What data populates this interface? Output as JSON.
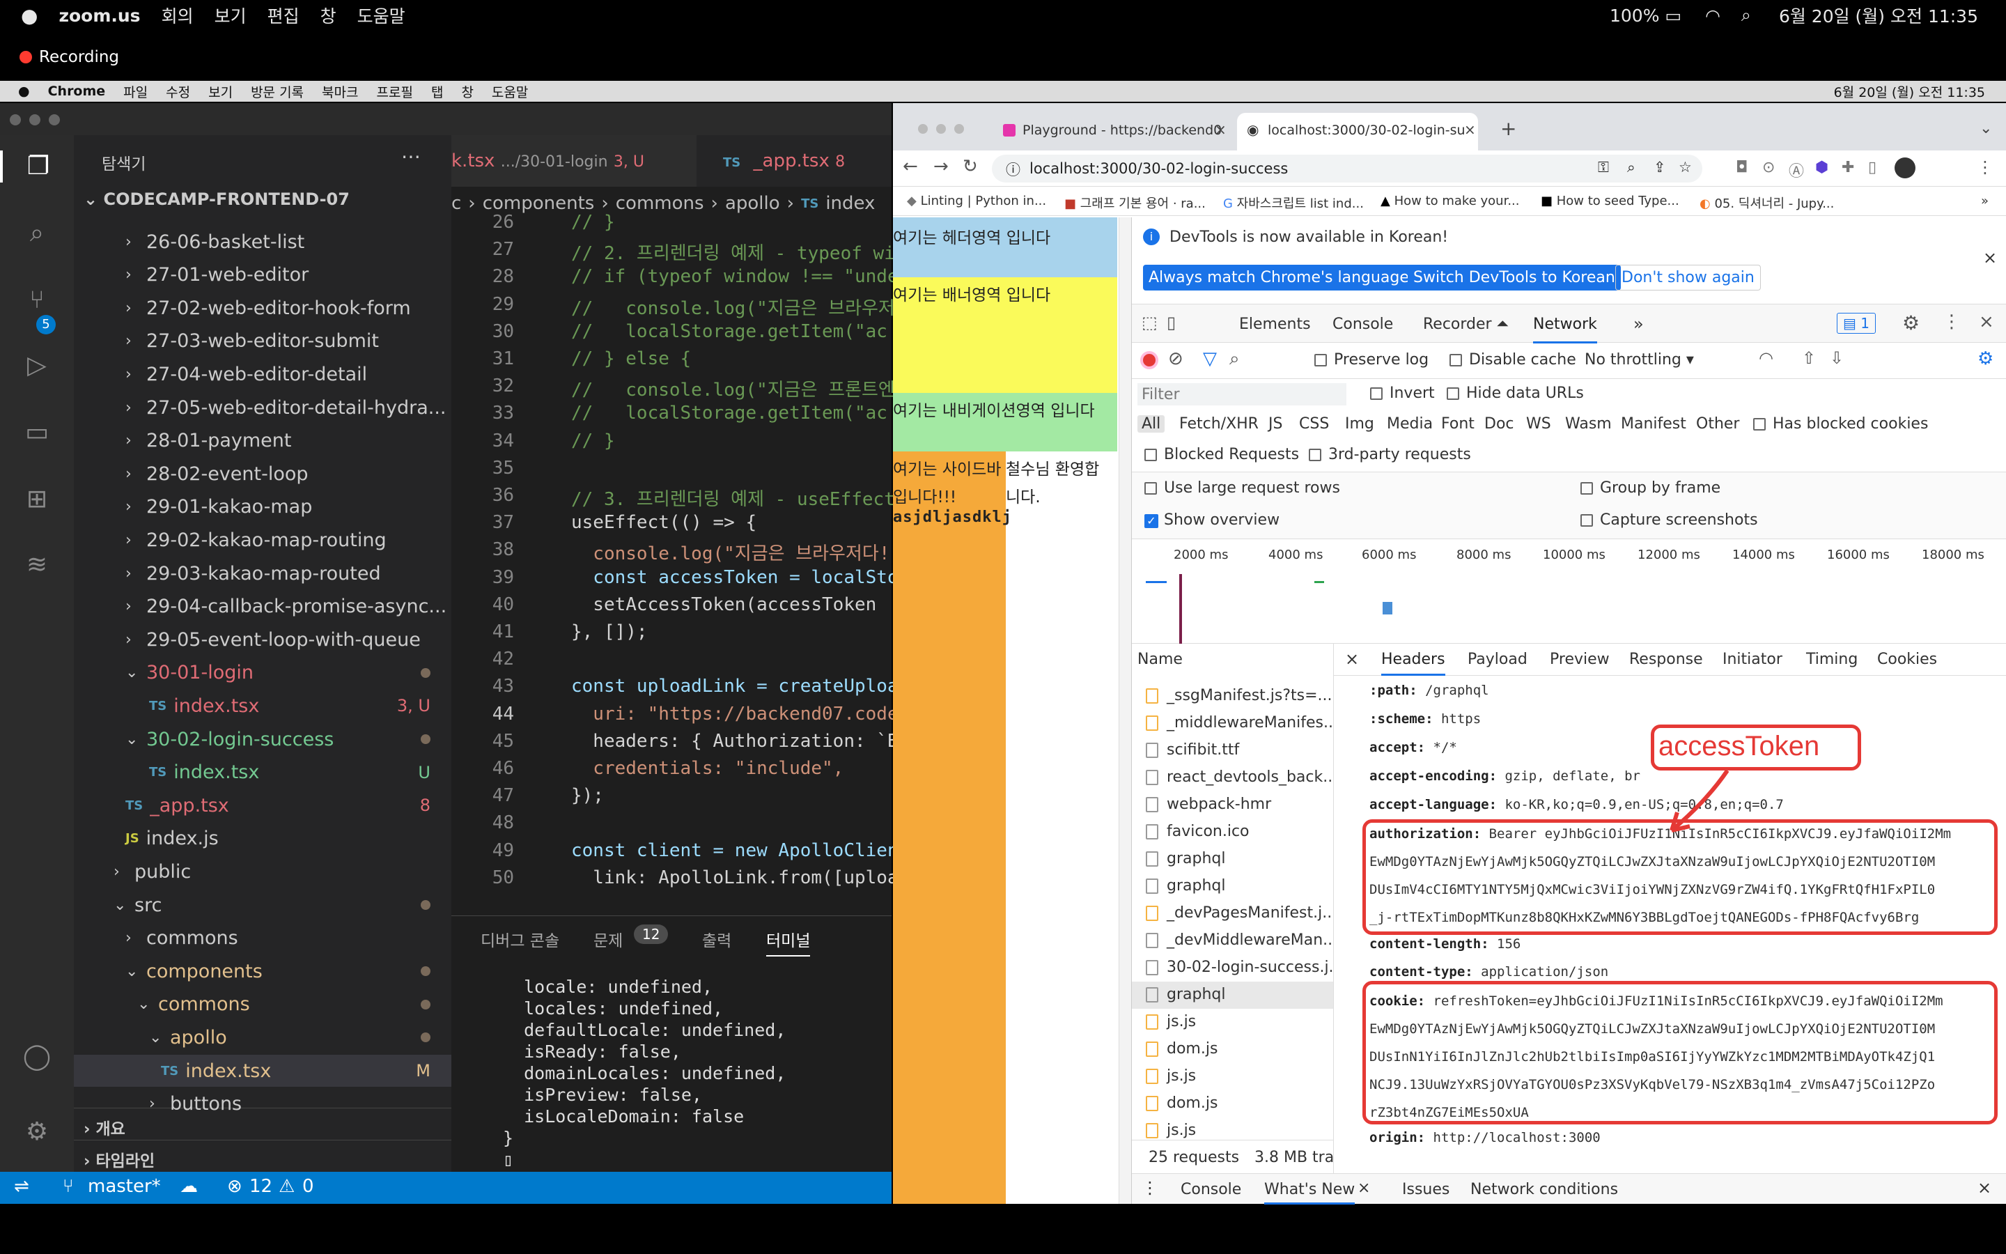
{
  "mac_menu": {
    "app": "zoom.us",
    "items": [
      "회의",
      "보기",
      "편집",
      "창",
      "도움말"
    ],
    "battery": "100%",
    "datetime": "6월 20일 (월) 오전 11:35"
  },
  "recording": "Recording",
  "chrome_menu": {
    "app": "Chrome",
    "items": [
      "파일",
      "수정",
      "보기",
      "방문 기록",
      "북마크",
      "프로필",
      "탭",
      "창",
      "도움말"
    ],
    "datetime": "6월 20일 (월) 오전 11:35"
  },
  "vscode": {
    "sidebar_title": "탐색기",
    "project": "CODECAMP-FRONTEND-07",
    "tree": [
      {
        "label": "26-06-basket-list",
        "indent": 1,
        "chev": "›"
      },
      {
        "label": "27-01-web-editor",
        "indent": 1,
        "chev": "›"
      },
      {
        "label": "27-02-web-editor-hook-form",
        "indent": 1,
        "chev": "›"
      },
      {
        "label": "27-03-web-editor-submit",
        "indent": 1,
        "chev": "›"
      },
      {
        "label": "27-04-web-editor-detail",
        "indent": 1,
        "chev": "›"
      },
      {
        "label": "27-05-web-editor-detail-hydra...",
        "indent": 1,
        "chev": "›"
      },
      {
        "label": "28-01-payment",
        "indent": 1,
        "chev": "›"
      },
      {
        "label": "28-02-event-loop",
        "indent": 1,
        "chev": "›"
      },
      {
        "label": "29-01-kakao-map",
        "indent": 1,
        "chev": "›"
      },
      {
        "label": "29-02-kakao-map-routing",
        "indent": 1,
        "chev": "›"
      },
      {
        "label": "29-03-kakao-map-routed",
        "indent": 1,
        "chev": "›"
      },
      {
        "label": "29-04-callback-promise-async...",
        "indent": 1,
        "chev": "›"
      },
      {
        "label": "29-05-event-loop-with-queue",
        "indent": 1,
        "chev": "›"
      },
      {
        "label": "30-01-login",
        "indent": 1,
        "chev": "⌄",
        "color": "#e06c75",
        "dot": true
      },
      {
        "label": "index.tsx",
        "indent": 2,
        "type": "ts",
        "color": "#e06c75",
        "badge": "3, U"
      },
      {
        "label": "30-02-login-success",
        "indent": 1,
        "chev": "⌄",
        "color": "#73c991",
        "dot": true
      },
      {
        "label": "index.tsx",
        "indent": 2,
        "type": "ts",
        "color": "#73c991",
        "badge": "U"
      },
      {
        "label": "_app.tsx",
        "indent": 1,
        "type": "ts",
        "color": "#e06c75",
        "badge": "8"
      },
      {
        "label": "index.js",
        "indent": 1,
        "type": "js"
      },
      {
        "label": "public",
        "indent": 0.5,
        "chev": "›"
      },
      {
        "label": "src",
        "indent": 0.5,
        "chev": "⌄",
        "dot": true
      },
      {
        "label": "commons",
        "indent": 1,
        "chev": "›"
      },
      {
        "label": "components",
        "indent": 1,
        "chev": "⌄",
        "color": "#e2c08d",
        "dot": true
      },
      {
        "label": "commons",
        "indent": 1.5,
        "chev": "⌄",
        "color": "#e2c08d",
        "dot": true
      },
      {
        "label": "apollo",
        "indent": 2,
        "chev": "⌄",
        "color": "#e2c08d",
        "dot": true
      },
      {
        "label": "index.tsx",
        "indent": 2.5,
        "type": "ts",
        "color": "#e2c08d",
        "badge": "M",
        "selected": true
      },
      {
        "label": "buttons",
        "indent": 2,
        "chev": "›"
      }
    ],
    "outline": "개요",
    "timeline": "타임라인",
    "tabs": [
      {
        "label": "k.tsx",
        "sub": ".../30-01-login",
        "badge": "3, U"
      },
      {
        "label": "_app.tsx",
        "badge": "8"
      }
    ],
    "breadcrumb": [
      "c",
      "components",
      "commons",
      "apollo",
      "index"
    ],
    "code": [
      {
        "n": "26",
        "t": "// }"
      },
      {
        "n": "27",
        "t": "// 2. 프리렌더링 예제 - typeof wi"
      },
      {
        "n": "28",
        "t": "// if (typeof window !== \"unde"
      },
      {
        "n": "29",
        "t": "//   console.log(\"지금은 브라우저"
      },
      {
        "n": "30",
        "t": "//   localStorage.getItem(\"ac"
      },
      {
        "n": "31",
        "t": "// } else {"
      },
      {
        "n": "32",
        "t": "//   console.log(\"지금은 프론트엔"
      },
      {
        "n": "33",
        "t": "//   localStorage.getItem(\"ac"
      },
      {
        "n": "34",
        "t": "// }"
      },
      {
        "n": "35",
        "t": ""
      },
      {
        "n": "36",
        "t": "// 3. 프리렌더링 예제 - useEffect"
      },
      {
        "n": "37",
        "t": "useEffect(() => {"
      },
      {
        "n": "38",
        "t": "  console.log(\"지금은 브라우저다!!"
      },
      {
        "n": "39",
        "t": "  const accessToken = localSto"
      },
      {
        "n": "40",
        "t": "  setAccessToken(accessToken"
      },
      {
        "n": "41",
        "t": "}, []);"
      },
      {
        "n": "42",
        "t": ""
      },
      {
        "n": "43",
        "t": "const uploadLink = createUploa"
      },
      {
        "n": "44",
        "t": "  uri: \"https://backend07.code"
      },
      {
        "n": "45",
        "t": "  headers: { Authorization: `B"
      },
      {
        "n": "46",
        "t": "  credentials: \"include\","
      },
      {
        "n": "47",
        "t": "});"
      },
      {
        "n": "48",
        "t": ""
      },
      {
        "n": "49",
        "t": "const client = new ApolloClien"
      },
      {
        "n": "50",
        "t": "  link: ApolloLink.from([uploa"
      }
    ],
    "panel_tabs": [
      "디버그 콘솔",
      "문제",
      "출력",
      "터미널"
    ],
    "problems_count": "12",
    "terminal": [
      "  locale: undefined,",
      "  locales: undefined,",
      "  defaultLocale: undefined,",
      "  isReady: false,",
      "  domainLocales: undefined,",
      "  isPreview: false,",
      "  isLocaleDomain: false",
      "}",
      "▯"
    ],
    "status": {
      "branch": "master*",
      "errors": "12",
      "warnings": "0"
    }
  },
  "chrome": {
    "tabs": [
      "Playground - https://backend0",
      "localhost:3000/30-02-login-su"
    ],
    "url": "localhost:3000/30-02-login-success",
    "bookmarks": [
      "Linting | Python in...",
      "그래프 기본 용어 · ra...",
      "자바스크립트 list ind...",
      "How to make your...",
      "How to seed Type...",
      "05. 딕셔너리 - Jupy..."
    ],
    "page": {
      "header": "여기는 헤더영역 입니다",
      "banner": "여기는 배너영역 입니다",
      "nav": "여기는 내비게이션영역 입니다",
      "sidebar": "여기는 사이드바 입니다!!!",
      "body": "철수님 환영합니다.",
      "scribble": "asjdljasdklj"
    },
    "devtools": {
      "notice": "DevTools is now available in Korean!",
      "btn1": "Always match Chrome's language",
      "btn2": "Switch DevTools to Korean",
      "btn3": "Don't show again",
      "tabs": [
        "Elements",
        "Console",
        "Recorder ⏶",
        "Network",
        "»"
      ],
      "issues": "1",
      "preserve": "Preserve log",
      "disable_cache": "Disable cache",
      "throttle": "No throttling",
      "filter": "Filter",
      "invert": "Invert",
      "hide_data": "Hide data URLs",
      "types": [
        "All",
        "Fetch/XHR",
        "JS",
        "CSS",
        "Img",
        "Media",
        "Font",
        "Doc",
        "WS",
        "Wasm",
        "Manifest",
        "Other"
      ],
      "blocked_cookies": "Has blocked cookies",
      "blocked_req": "Blocked Requests",
      "third_party": "3rd-party requests",
      "large_rows": "Use large request rows",
      "group_frame": "Group by frame",
      "overview": "Show overview",
      "capture": "Capture screenshots",
      "timeline": [
        "2000 ms",
        "4000 ms",
        "6000 ms",
        "8000 ms",
        "10000 ms",
        "12000 ms",
        "14000 ms",
        "16000 ms",
        "18000 ms"
      ],
      "name_col": "Name",
      "requests": [
        "_ssgManifest.js?ts=...",
        "_middlewareManifes...",
        "scifibit.ttf",
        "react_devtools_back...",
        "webpack-hmr",
        "favicon.ico",
        "graphql",
        "graphql",
        "_devPagesManifest.j...",
        "_devMiddlewareMan...",
        "30-02-login-success.j...",
        "graphql",
        "js.js",
        "dom.js",
        "js.js",
        "dom.js",
        "js.js"
      ],
      "summary": "25 requests",
      "transfer": "3.8 MB tran",
      "detail_tabs": [
        "Headers",
        "Payload",
        "Preview",
        "Response",
        "Initiator",
        "Timing",
        "Cookies"
      ],
      "headers": [
        {
          "k": ":path:",
          "v": "/graphql"
        },
        {
          "k": ":scheme:",
          "v": "https"
        },
        {
          "k": "accept:",
          "v": "*/*"
        },
        {
          "k": "accept-encoding:",
          "v": "gzip, deflate, br"
        },
        {
          "k": "accept-language:",
          "v": "ko-KR,ko;q=0.9,en-US;q=0.8,en;q=0.7"
        }
      ],
      "auth_key": "authorization:",
      "auth_lines": [
        "Bearer eyJhbGciOiJFUzI1NiIsInR5cCI6IkpXVCJ9.eyJfaWQiOiI2Mm",
        "EwMDg0YTAzNjEwYjAwMjk5OGQyZTQiLCJwZXJtaXNzaW9uIjowLCJpYXQiOjE2NTU2OTI0M",
        "DUsImV4cCI6MTY1NTY5MjQxMCwic3ViIjoiYWNjZXNzVG9rZW4ifQ.1YKgFRtQfH1FxPIL0",
        "_j-rtTExTimDopMTKunz8b8QKHxKZwMN6Y3BBLgdToejtQANEGODs-fPH8FQAcfvy6Brg"
      ],
      "clen_key": "content-length:",
      "clen": "156",
      "ctype_key": "content-type:",
      "ctype": "application/json",
      "cookie_key": "cookie:",
      "cookie_lines": [
        "refreshToken=eyJhbGciOiJFUzI1NiIsInR5cCI6IkpXVCJ9.eyJfaWQiOiI2Mm",
        "EwMDg0YTAzNjEwYjAwMjk5OGQyZTQiLCJwZXJtaXNzaW9uIjowLCJpYXQiOjE2NTU2OTI0M",
        "DUsInN1YiI6InJlZnJlc2hUb2tlbiIsImp0aSI6IjYyYWZkYzc1MDM2MTBiMDAyOTk4ZjQ1",
        "NCJ9.13UuWzYxRSjOVYaTGYOU0sPz3XSVyKqbVel79-NSzXB3q1m4_zVmsA47j5Coi12PZo",
        "rZ3bt4nZG7EiMEs5OxUA"
      ],
      "origin_key": "origin:",
      "origin": "http://localhost:3000",
      "annotation": "accessToken",
      "drawer_tabs": [
        "Console",
        "What's New",
        "Issues",
        "Network conditions"
      ]
    }
  }
}
